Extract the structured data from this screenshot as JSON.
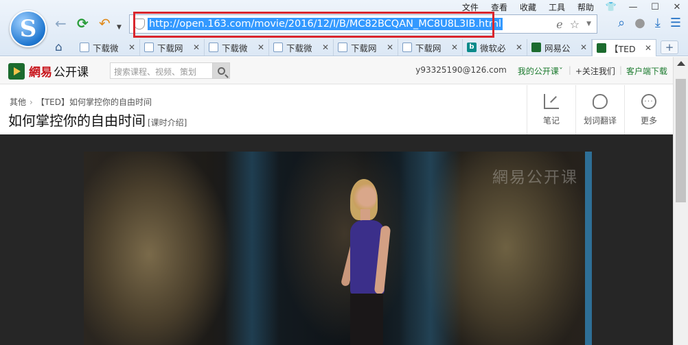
{
  "browser": {
    "menu": [
      "文件",
      "查看",
      "收藏",
      "工具",
      "帮助"
    ],
    "logo_letter": "S",
    "url": "http://open.163.com/movie/2016/12/I/B/MC82BCQAN_MC8U8L3IB.html",
    "tabs": [
      {
        "label": "下载微",
        "icon": "page-icon"
      },
      {
        "label": "下载网",
        "icon": "page-icon"
      },
      {
        "label": "下载微",
        "icon": "page-icon"
      },
      {
        "label": "下载微",
        "icon": "page-icon"
      },
      {
        "label": "下载网",
        "icon": "page-icon"
      },
      {
        "label": "下载网",
        "icon": "page-icon"
      },
      {
        "label": "微软必",
        "icon": "bing-icon"
      },
      {
        "label": "网易公",
        "icon": "netease-icon"
      },
      {
        "label": "【TED",
        "icon": "ted-icon"
      }
    ],
    "active_tab": 8,
    "accent": "#3399ff",
    "highlight_box": "#d9262d"
  },
  "site": {
    "brand_red": "網易",
    "brand_black": "公开课",
    "search_placeholder": "搜索课程、视频、策划",
    "email": "y93325190@126.com",
    "my_courses": "我的公开课",
    "follow": "+关注我们",
    "client_download": "客户端下载"
  },
  "course": {
    "crumb_parent": "其他",
    "crumb_current": "【TED】如何掌控你的自由时间",
    "title": "如何掌控你的自由时间",
    "intro_link": "[课时介绍]",
    "actions": [
      "笔记",
      "划词翻译",
      "更多"
    ]
  },
  "video": {
    "watermark": "網易公开课"
  }
}
